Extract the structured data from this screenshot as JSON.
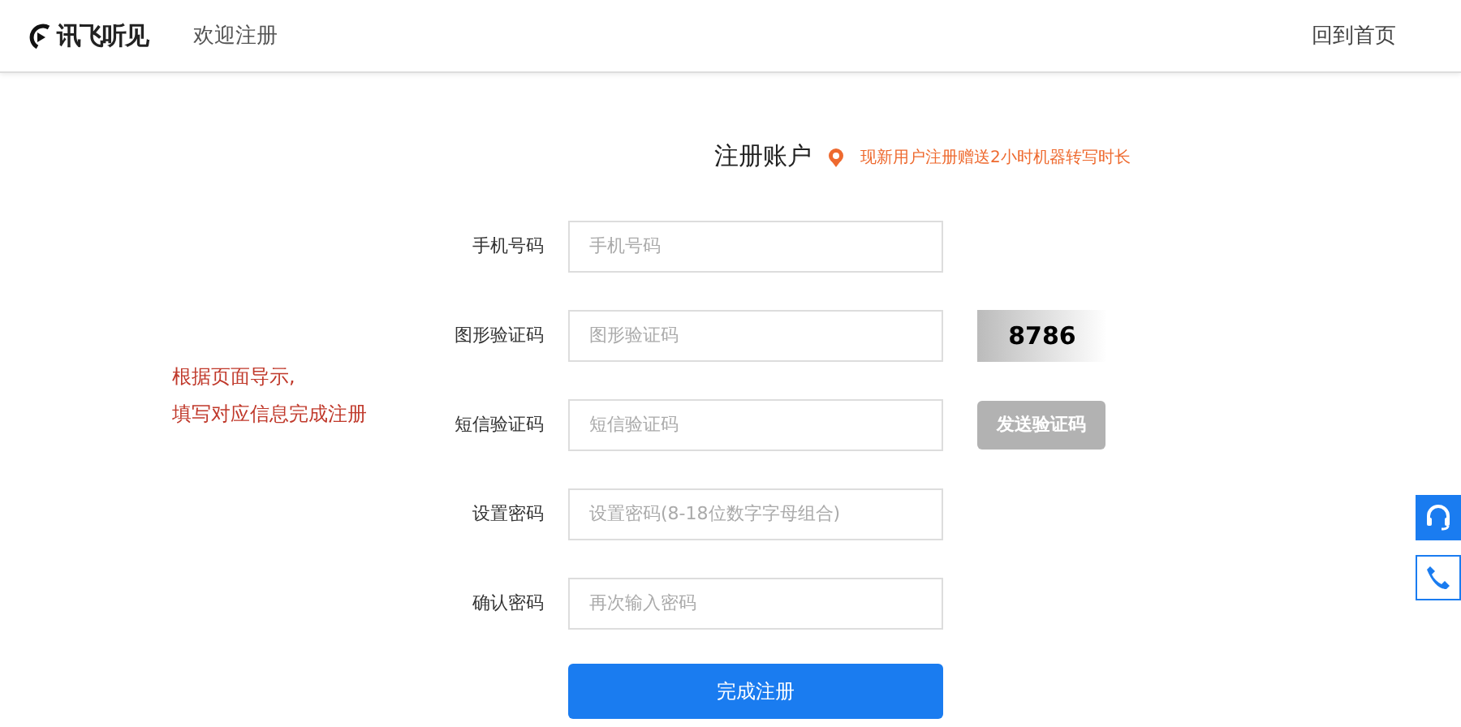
{
  "header": {
    "logo": "讯飞听见",
    "page_title": "欢迎注册",
    "home_link": "回到首页"
  },
  "form": {
    "title": "注册账户",
    "promo": "现新用户注册赠送2小时机器转写时长",
    "fields": [
      {
        "kind": "plain",
        "label": "手机号码",
        "placeholder": "手机号码"
      },
      {
        "kind": "captcha",
        "label": "图形验证码",
        "placeholder": "图形验证码",
        "captcha": "8786"
      },
      {
        "kind": "sms",
        "label": "短信验证码",
        "placeholder": "短信验证码",
        "button": "发送验证码",
        "disabled": true
      },
      {
        "kind": "plain",
        "label": "设置密码",
        "placeholder": "设置密码(8-18位数字字母组合)"
      },
      {
        "kind": "plain",
        "label": "确认密码",
        "placeholder": "再次输入密码"
      }
    ],
    "submit": "完成注册"
  },
  "annotation": [
    "根据页面导示,",
    "填写对应信息完成注册"
  ]
}
